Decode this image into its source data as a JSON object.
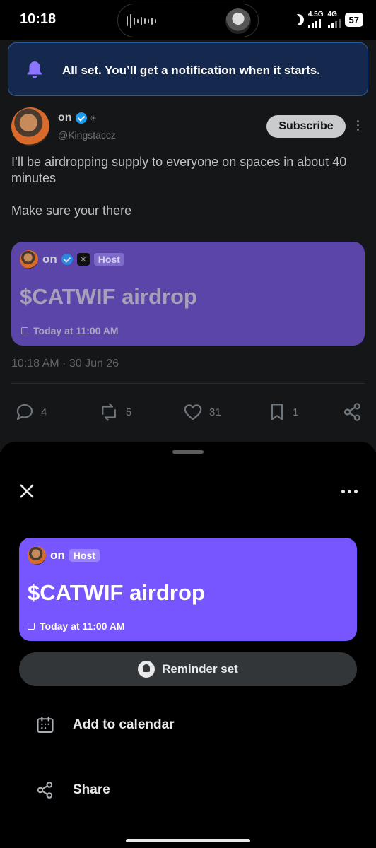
{
  "status_bar": {
    "time": "10:18",
    "network_1": "4.5G",
    "network_2": "4G",
    "battery": "57"
  },
  "banner": {
    "message": "All set. You’ll get a notification when it starts."
  },
  "tweet": {
    "author_name": "on",
    "handle": "@Kingstaccz",
    "subscribe_label": "Subscribe",
    "text_line1": "I’ll be airdropping supply to everyone on spaces in about 40 minutes",
    "text_line2": "Make sure your there",
    "timestamp": "10:18 AM · 30 Jun 26",
    "replies": "4",
    "reposts": "5",
    "likes": "31",
    "bookmarks": "1"
  },
  "space": {
    "host_name": "on",
    "host_tag": "Host",
    "title": "$CATWIF airdrop",
    "when": "Today at 11:00 AM"
  },
  "sheet": {
    "reminder_label": "Reminder set",
    "add_calendar_label": "Add to calendar",
    "share_label": "Share"
  },
  "colors": {
    "space_purple": "#7856ff",
    "banner_bg": "#14294d",
    "verified_blue": "#1d9bf0"
  }
}
